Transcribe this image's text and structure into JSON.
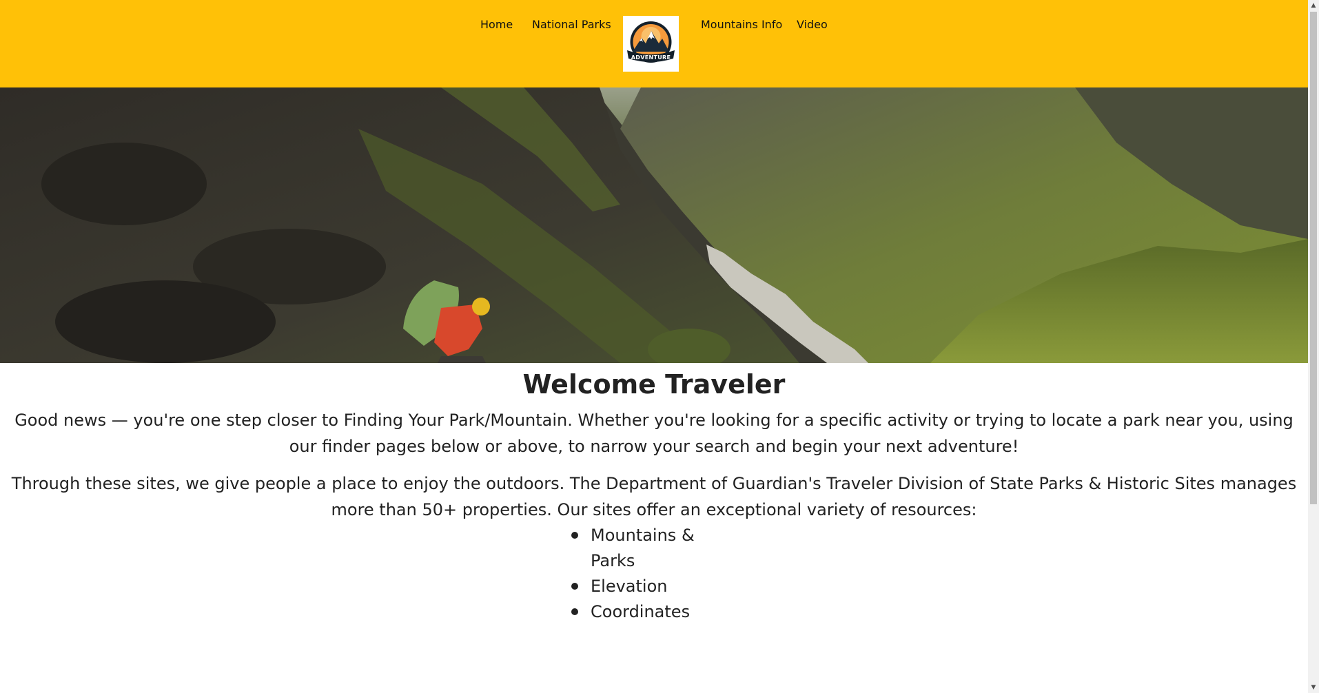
{
  "nav": {
    "home": "Home",
    "national_parks": "National Parks",
    "mountains_info": "Mountains Info",
    "video": "Video",
    "logo_text": "ADVENTURE"
  },
  "hero": {
    "icon": "mountain-hiker-photo"
  },
  "content": {
    "title": "Welcome Traveler",
    "paragraph1": "Good news — you're one step closer to Finding Your Park/Mountain. Whether you're looking for a specific activity or trying to locate a park near you, using our finder pages below or above, to narrow your search and begin your next adventure!",
    "paragraph2": "Through these sites, we give people a place to enjoy the outdoors. The Department of Guardian's Traveler Division of State Parks & Historic Sites manages more than 50+ properties. Our sites offer an exceptional variety of resources:",
    "resources": [
      "Mountains & Parks",
      "Elevation",
      "Coordinates"
    ]
  },
  "colors": {
    "header_bg": "#ffc107",
    "text": "#222222"
  }
}
